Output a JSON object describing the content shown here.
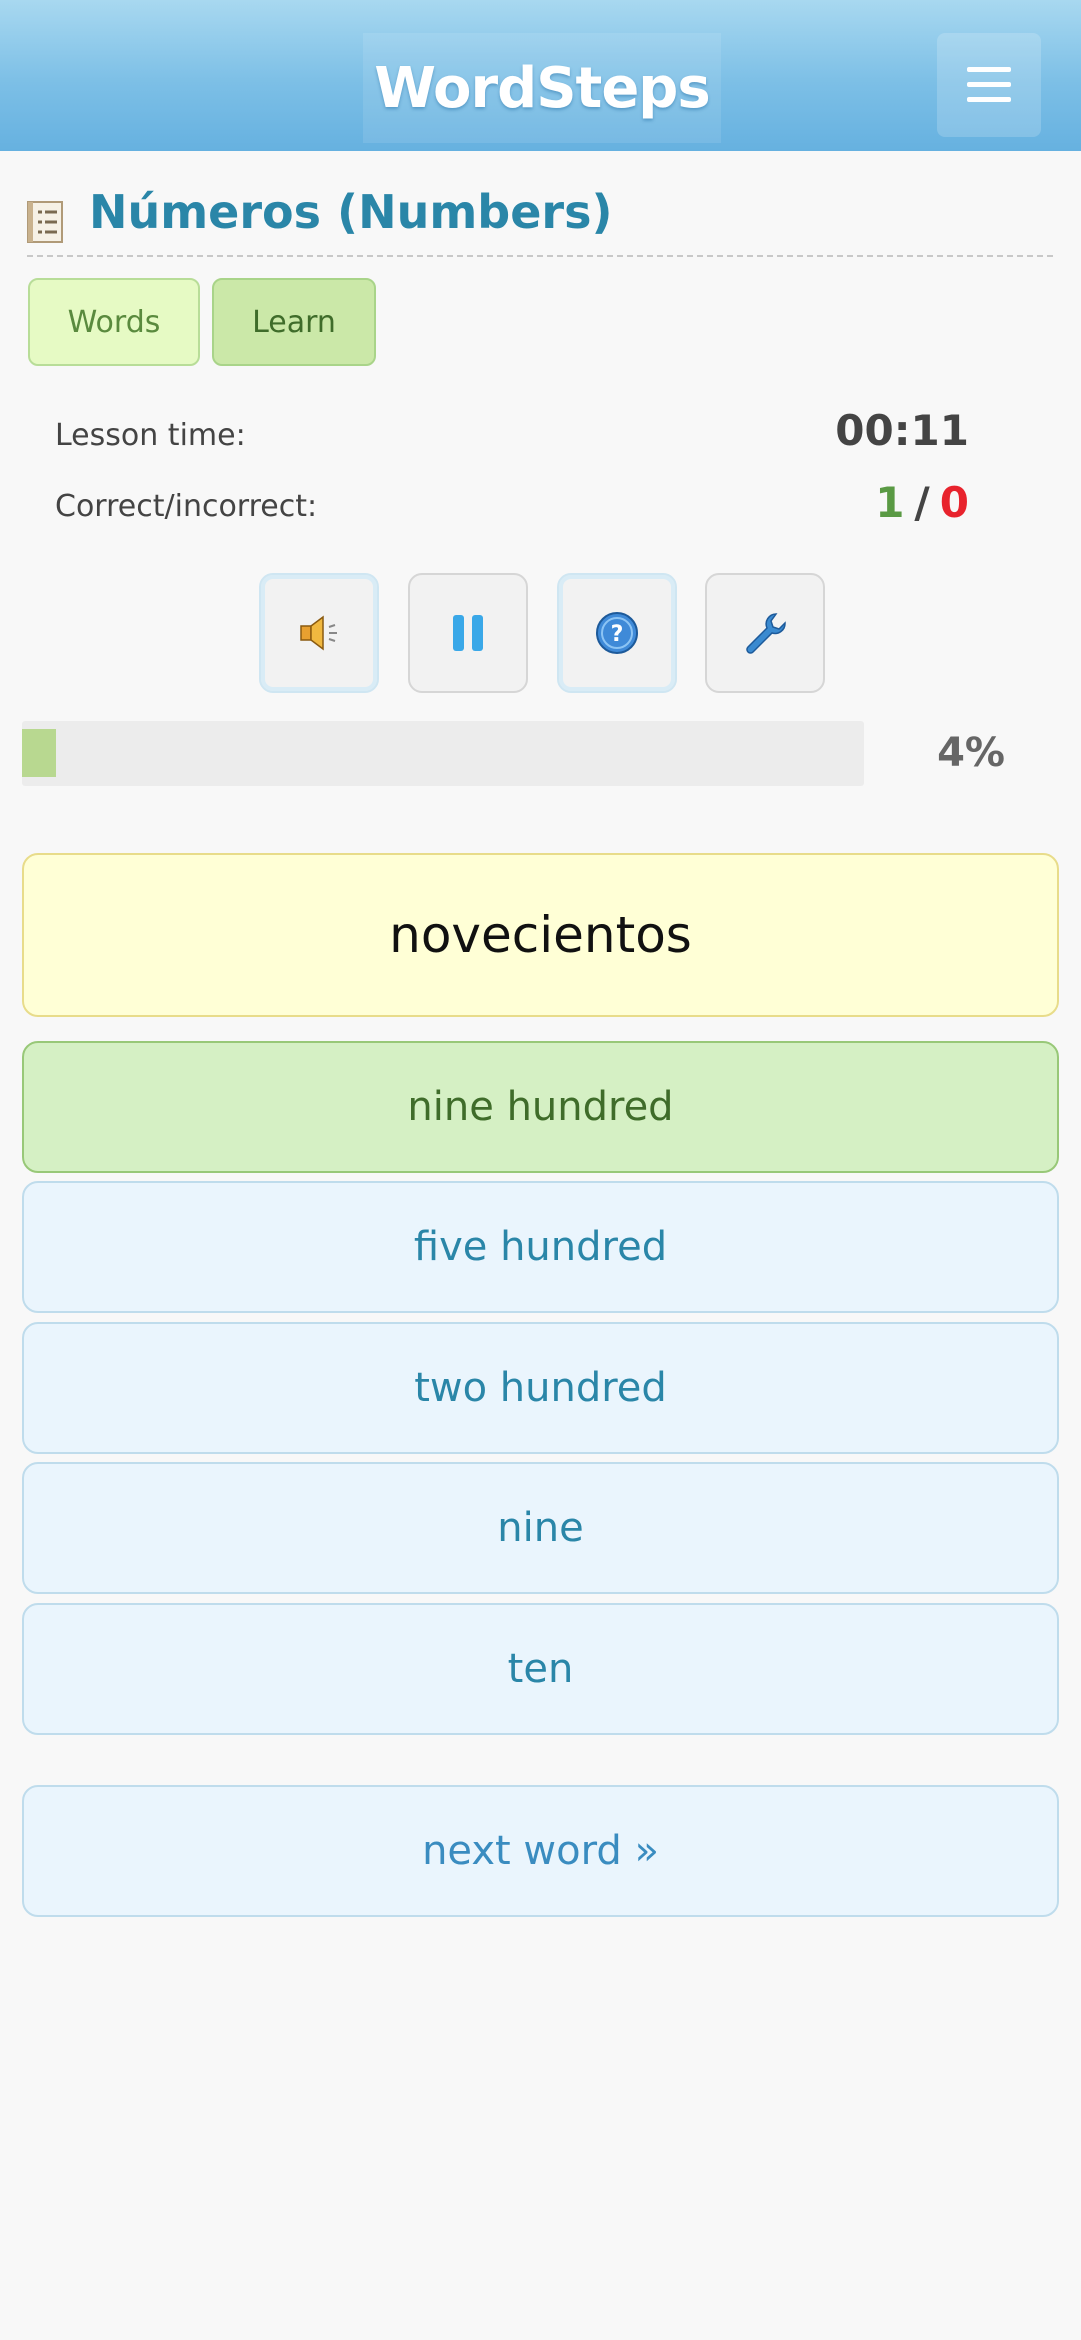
{
  "header": {
    "logo_text": "WordSteps",
    "menu_icon": "hamburger-menu-icon"
  },
  "lesson": {
    "title": "Números (Numbers)",
    "title_icon": "list-icon"
  },
  "tabs": [
    {
      "label": "Words",
      "active": false
    },
    {
      "label": "Learn",
      "active": true
    }
  ],
  "stats": {
    "lesson_time_label": "Lesson time:",
    "lesson_time_value": "00:11",
    "score_label": "Correct/incorrect:",
    "correct": "1",
    "separator": "/",
    "incorrect": "0",
    "correct_color": "#5a9a44",
    "incorrect_color": "#e8232d"
  },
  "controls": [
    {
      "name": "speaker-icon"
    },
    {
      "name": "pause-icon"
    },
    {
      "name": "help-icon"
    },
    {
      "name": "wrench-icon"
    }
  ],
  "progress": {
    "percent": 4,
    "label": "4%"
  },
  "word": "novecientos",
  "answers": [
    {
      "label": "nine hundred",
      "state": "correct"
    },
    {
      "label": "five hundred",
      "state": "option"
    },
    {
      "label": "two hundred",
      "state": "option"
    },
    {
      "label": "nine",
      "state": "option"
    },
    {
      "label": "ten",
      "state": "option"
    }
  ],
  "next_button": "next word »"
}
